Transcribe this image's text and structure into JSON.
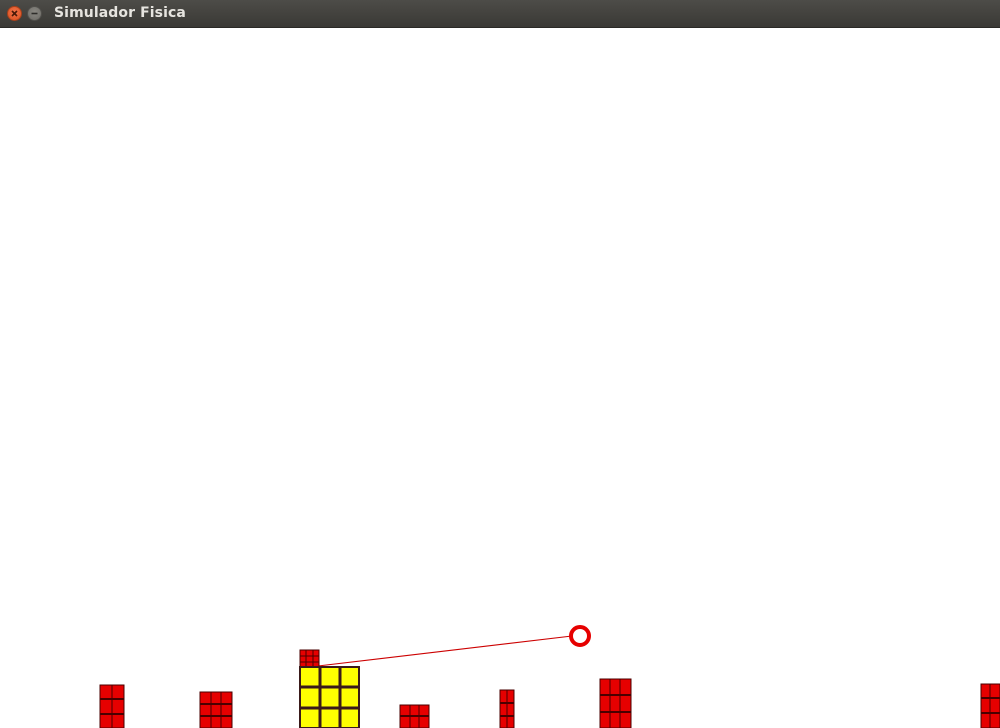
{
  "window": {
    "title": "Simulador Fisica",
    "controls": [
      "close-icon",
      "minimize-icon"
    ]
  },
  "scene": {
    "colors": {
      "brick": "#e60000",
      "brick_lines": "#4a0000",
      "highlight_block": "#ffff00",
      "highlight_lines": "#3a1a1a",
      "rope": "#cc0000",
      "ball": "#e60000"
    }
  }
}
